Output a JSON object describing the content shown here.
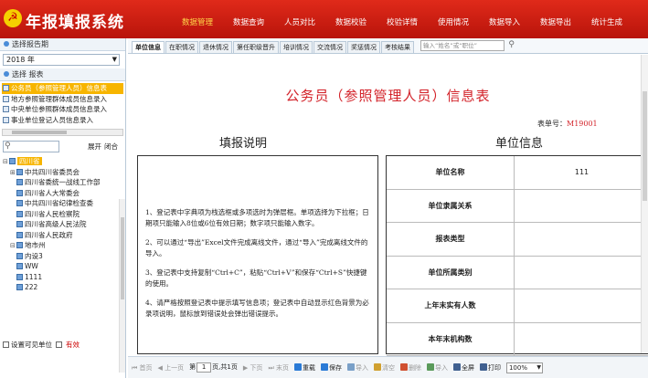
{
  "header": {
    "emblem": "☭",
    "title": "年报填报系统",
    "nav": [
      "数据管理",
      "数据查询",
      "人员对比",
      "数据校验",
      "校验详情",
      "使用情况",
      "数据导入",
      "数据导出",
      "统计生成"
    ],
    "active_nav": 0
  },
  "sidebar": {
    "section1_title": "选择报告期",
    "year": "2018 年",
    "section2_title": "选择 报表",
    "tables": [
      "公务员（参照管理人员）信息表",
      "地方参照管理群体成员信息录入",
      "中央单位参照群体成员信息录入",
      "事业单位登记人员信息录入"
    ],
    "selected_table": 0,
    "expand_label": "展开",
    "collapse_label": "闭合",
    "tree": [
      {
        "label": "四川省",
        "level": 0,
        "exp": "⊟"
      },
      {
        "label": "中共四川省委员会",
        "level": 1,
        "exp": "⊞"
      },
      {
        "label": "四川省委统一战线工作部",
        "level": 1,
        "exp": ""
      },
      {
        "label": "四川省人大常委会",
        "level": 1,
        "exp": ""
      },
      {
        "label": "中共四川省纪律检查委",
        "level": 1,
        "exp": ""
      },
      {
        "label": "四川省人民检察院",
        "level": 1,
        "exp": ""
      },
      {
        "label": "四川省高级人民法院",
        "level": 1,
        "exp": ""
      },
      {
        "label": "四川省人民政府",
        "level": 1,
        "exp": ""
      },
      {
        "label": "地市州",
        "level": 1,
        "exp": "⊟"
      },
      {
        "label": "内设3",
        "level": 1,
        "exp": ""
      },
      {
        "label": "WW",
        "level": 1,
        "exp": ""
      },
      {
        "label": "1111",
        "level": 1,
        "exp": ""
      },
      {
        "label": "222",
        "level": 1,
        "exp": ""
      }
    ],
    "footer_label": "设置可见单位",
    "footer_valid": "有效"
  },
  "tabs": [
    "单位信息",
    "在职情况",
    "退休情况",
    "第任职级晋升",
    "培训情况",
    "交流情况",
    "奖惩情况",
    "考核结果"
  ],
  "active_tab": 0,
  "search_placeholder": "输入“姓名”或“职位”",
  "form": {
    "title": "公务员（参照管理人员）信息表",
    "table_no_label": "表单号：",
    "table_no": "M19001",
    "instructions_heading": "填报说明",
    "unit_heading": "单位信息",
    "instructions": [
      "1、登记表中字典项为栈选框或多项选时为弹层框。单项选择为下拉框；日期项只能输入8位或6位有效日期；数字项只能输入数字。",
      "2、可以通过“导出”Excel文件完成离线文件，通过“导入”完成离线文件的导入。",
      "3、登记表中支持复制“Ctrl+C”，粘贴“Ctrl+V”和保存“Ctrl+S”快捷键的使用。",
      "4、请严格按照登记表中提示填写信息项；登记表中自动显示红色背景为必录项说明，鼠标放到错误处会弹出错误提示。"
    ],
    "unit_rows": [
      {
        "label": "单位名称",
        "value": "111"
      },
      {
        "label": "单位隶属关系",
        "value": ""
      },
      {
        "label": "报表类型",
        "value": ""
      },
      {
        "label": "单位所属类别",
        "value": ""
      },
      {
        "label": "上年末实有人数",
        "value": ""
      },
      {
        "label": "本年末机构数",
        "value": ""
      }
    ]
  },
  "pager": {
    "first": "首页",
    "prev": "上一页",
    "page_prefix": "第",
    "page": "1",
    "page_suffix": "页,共1页",
    "next": "下页",
    "last": "末页",
    "actions": [
      {
        "label": "重载",
        "color": "#2a7ad6",
        "enabled": true
      },
      {
        "label": "保存",
        "color": "#2a7ad6",
        "enabled": true
      },
      {
        "label": "导入",
        "color": "#7aa0c8",
        "enabled": false
      },
      {
        "label": "清空",
        "color": "#d0a030",
        "enabled": false
      },
      {
        "label": "删除",
        "color": "#d05030",
        "enabled": false
      },
      {
        "label": "导入",
        "color": "#5a9a5a",
        "enabled": false
      },
      {
        "label": "全屏",
        "color": "#406090",
        "enabled": true
      },
      {
        "label": "打印",
        "color": "#406090",
        "enabled": true
      }
    ],
    "zoom": "100%"
  }
}
